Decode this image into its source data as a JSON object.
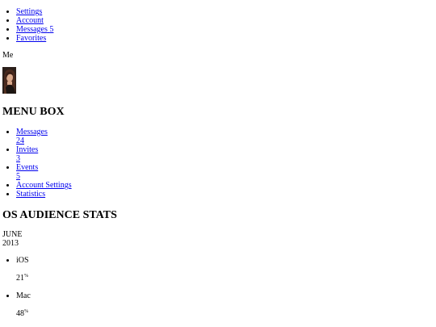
{
  "top_nav": {
    "settings": "Settings",
    "account": "Account",
    "messages": "Messages",
    "messages_count": "5",
    "favorites": "Favorites"
  },
  "user": {
    "label": "Me"
  },
  "menu_box": {
    "title": "MENU BOX",
    "items": [
      {
        "label": "Messages",
        "count": "24"
      },
      {
        "label": "Invites",
        "count": "3"
      },
      {
        "label": "Events",
        "count": "5"
      },
      {
        "label": "Account Settings"
      },
      {
        "label": "Statistics"
      }
    ]
  },
  "stats": {
    "title": "OS AUDIENCE STATS",
    "month": "JUNE",
    "year": "2013",
    "os": [
      {
        "name": "iOS",
        "value": "21",
        "unit": "%"
      },
      {
        "name": "Mac",
        "value": "48",
        "unit": "%"
      }
    ]
  }
}
